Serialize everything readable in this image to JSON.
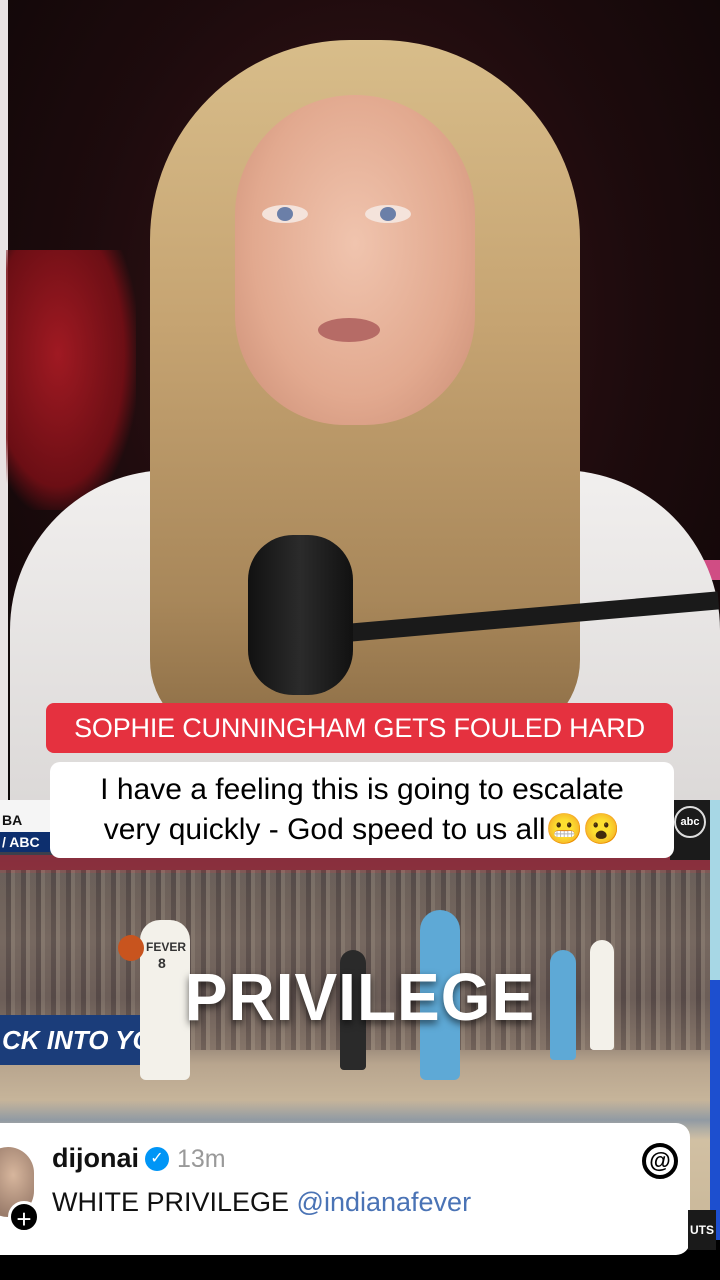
{
  "captions": {
    "headline": "SOPHIE CUNNINGHAM GETS FOULED HARD",
    "subtitle_line1": "I have a feeling this is going to escalate",
    "subtitle_line2": "very quickly - God speed to us all😬😮"
  },
  "clip": {
    "overlay_word": "PRIVILEGE",
    "network_bug_line1": "BA",
    "network_bug_line2": "/ ABC",
    "abc_logo": "abc",
    "ad_board_text": "CK INTO YOUR HO",
    "jersey_team": "FEVER",
    "jersey_number": "8"
  },
  "post": {
    "username": "dijonai",
    "verified": true,
    "time": "13m",
    "text": "WHITE PRIVILEGE ",
    "mention": "@indianafever",
    "app_icon": "threads-icon",
    "add_icon": "+"
  },
  "colors": {
    "headline_bg": "#e5313f",
    "mention": "#4a73b5",
    "verified": "#0095f6"
  }
}
